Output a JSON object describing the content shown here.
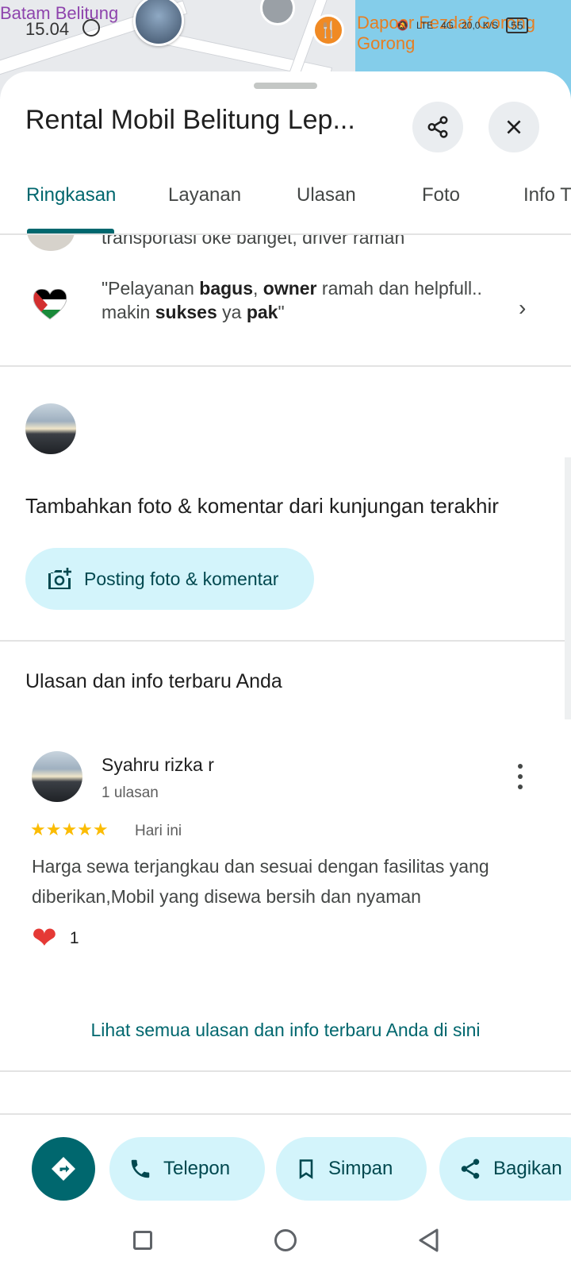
{
  "map": {
    "label_left": "Batam Belitung",
    "time": "15.04",
    "label_right_line1": "Dapoer Fezdaf Gorong",
    "label_right_line2": "Gorong",
    "network": "LTE",
    "signal": "4G",
    "speed": "20,0",
    "speed_unit": "K/S",
    "battery": "55"
  },
  "place": {
    "title": "Rental Mobil Belitung Lep..."
  },
  "tabs": [
    {
      "label": "Ringkasan",
      "active": true
    },
    {
      "label": "Layanan",
      "active": false
    },
    {
      "label": "Ulasan",
      "active": false
    },
    {
      "label": "Foto",
      "active": false
    },
    {
      "label": "Info T",
      "active": false
    }
  ],
  "snippets": {
    "partial": "transportasi oke banget, driver ramah",
    "quote_parts": [
      "\"Pelayanan ",
      "bagus",
      ", ",
      "owner",
      " ramah dan helpfull.. makin ",
      "sukses",
      " ya ",
      "pak",
      "\""
    ]
  },
  "add_visit": {
    "title": "Tambahkan foto & komentar dari kunjungan terakhir",
    "button_label": "Posting foto & komentar"
  },
  "your_reviews": {
    "title": "Ulasan dan info terbaru Anda",
    "reviewer_name": "Syahru rizka r",
    "reviewer_count": "1 ulasan",
    "rating": 5,
    "stars": "★★★★★",
    "date": "Hari ini",
    "text": "Harga sewa terjangkau dan sesuai dengan fasilitas yang diberikan,Mobil yang disewa bersih dan nyaman",
    "likes": "1",
    "see_all": "Lihat semua ulasan dan info terbaru Anda di sini"
  },
  "actions": {
    "call": "Telepon",
    "save": "Simpan",
    "share": "Bagikan"
  },
  "colors": {
    "accent": "#00676e",
    "pill_bg": "#d3f4fb",
    "star": "#fbbc04"
  }
}
